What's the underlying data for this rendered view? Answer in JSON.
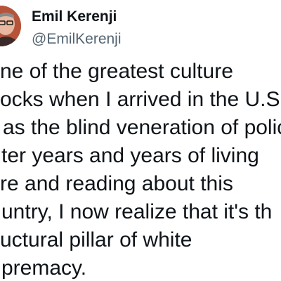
{
  "author": {
    "display_name": "Emil Kerenji",
    "handle": "@EmilKerenji"
  },
  "tweet": {
    "lines": [
      "ne of the greatest culture",
      "ocks when I arrived in the U.S",
      "as the blind veneration of polic",
      "ter years and years of living",
      "re and reading about this",
      "untry, I now realize that it's th",
      "uctural pillar of white",
      "premacy."
    ]
  }
}
